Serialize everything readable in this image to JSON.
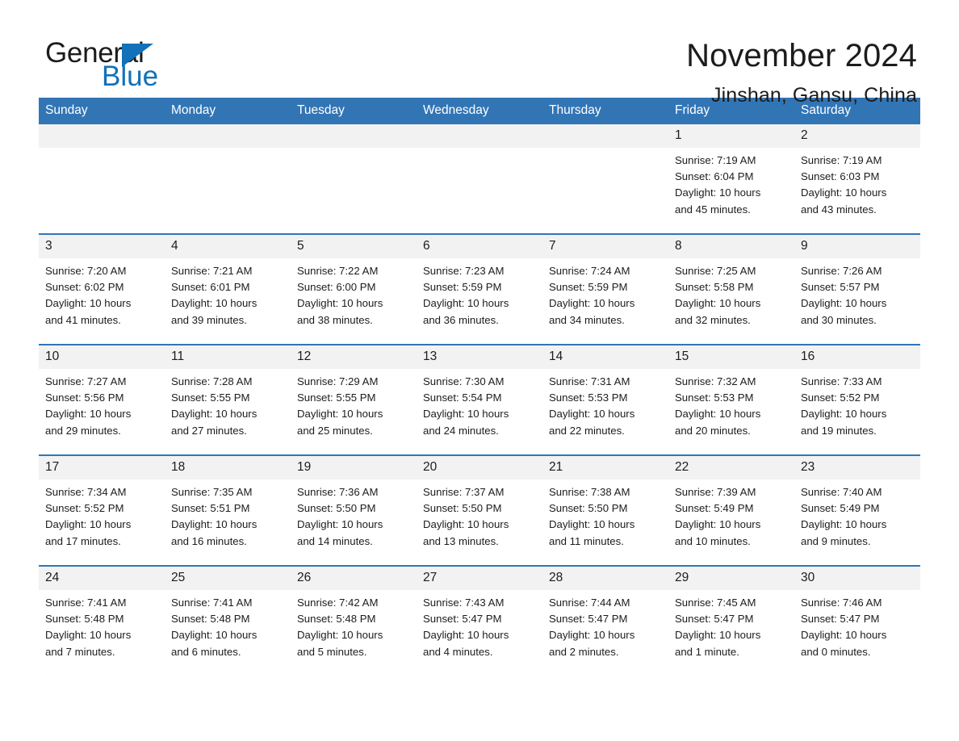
{
  "logo": {
    "word_one": "General",
    "word_two": "Blue",
    "triangle_color": "#1271b8"
  },
  "header": {
    "title": "November 2024",
    "subtitle": "Jinshan, Gansu, China"
  },
  "theme": {
    "header_blue": "#3275b5",
    "daynum_gray": "#f2f2f2",
    "text": "#1c1c1c"
  },
  "calendar": {
    "weekday_headers": [
      "Sunday",
      "Monday",
      "Tuesday",
      "Wednesday",
      "Thursday",
      "Friday",
      "Saturday"
    ],
    "weeks": [
      [
        {
          "day": "",
          "blank": true
        },
        {
          "day": "",
          "blank": true
        },
        {
          "day": "",
          "blank": true
        },
        {
          "day": "",
          "blank": true
        },
        {
          "day": "",
          "blank": true
        },
        {
          "day": "1",
          "sunrise": "Sunrise: 7:19 AM",
          "sunset": "Sunset: 6:04 PM",
          "daylight_1": "Daylight: 10 hours",
          "daylight_2": "and 45 minutes."
        },
        {
          "day": "2",
          "sunrise": "Sunrise: 7:19 AM",
          "sunset": "Sunset: 6:03 PM",
          "daylight_1": "Daylight: 10 hours",
          "daylight_2": "and 43 minutes."
        }
      ],
      [
        {
          "day": "3",
          "sunrise": "Sunrise: 7:20 AM",
          "sunset": "Sunset: 6:02 PM",
          "daylight_1": "Daylight: 10 hours",
          "daylight_2": "and 41 minutes."
        },
        {
          "day": "4",
          "sunrise": "Sunrise: 7:21 AM",
          "sunset": "Sunset: 6:01 PM",
          "daylight_1": "Daylight: 10 hours",
          "daylight_2": "and 39 minutes."
        },
        {
          "day": "5",
          "sunrise": "Sunrise: 7:22 AM",
          "sunset": "Sunset: 6:00 PM",
          "daylight_1": "Daylight: 10 hours",
          "daylight_2": "and 38 minutes."
        },
        {
          "day": "6",
          "sunrise": "Sunrise: 7:23 AM",
          "sunset": "Sunset: 5:59 PM",
          "daylight_1": "Daylight: 10 hours",
          "daylight_2": "and 36 minutes."
        },
        {
          "day": "7",
          "sunrise": "Sunrise: 7:24 AM",
          "sunset": "Sunset: 5:59 PM",
          "daylight_1": "Daylight: 10 hours",
          "daylight_2": "and 34 minutes."
        },
        {
          "day": "8",
          "sunrise": "Sunrise: 7:25 AM",
          "sunset": "Sunset: 5:58 PM",
          "daylight_1": "Daylight: 10 hours",
          "daylight_2": "and 32 minutes."
        },
        {
          "day": "9",
          "sunrise": "Sunrise: 7:26 AM",
          "sunset": "Sunset: 5:57 PM",
          "daylight_1": "Daylight: 10 hours",
          "daylight_2": "and 30 minutes."
        }
      ],
      [
        {
          "day": "10",
          "sunrise": "Sunrise: 7:27 AM",
          "sunset": "Sunset: 5:56 PM",
          "daylight_1": "Daylight: 10 hours",
          "daylight_2": "and 29 minutes."
        },
        {
          "day": "11",
          "sunrise": "Sunrise: 7:28 AM",
          "sunset": "Sunset: 5:55 PM",
          "daylight_1": "Daylight: 10 hours",
          "daylight_2": "and 27 minutes."
        },
        {
          "day": "12",
          "sunrise": "Sunrise: 7:29 AM",
          "sunset": "Sunset: 5:55 PM",
          "daylight_1": "Daylight: 10 hours",
          "daylight_2": "and 25 minutes."
        },
        {
          "day": "13",
          "sunrise": "Sunrise: 7:30 AM",
          "sunset": "Sunset: 5:54 PM",
          "daylight_1": "Daylight: 10 hours",
          "daylight_2": "and 24 minutes."
        },
        {
          "day": "14",
          "sunrise": "Sunrise: 7:31 AM",
          "sunset": "Sunset: 5:53 PM",
          "daylight_1": "Daylight: 10 hours",
          "daylight_2": "and 22 minutes."
        },
        {
          "day": "15",
          "sunrise": "Sunrise: 7:32 AM",
          "sunset": "Sunset: 5:53 PM",
          "daylight_1": "Daylight: 10 hours",
          "daylight_2": "and 20 minutes."
        },
        {
          "day": "16",
          "sunrise": "Sunrise: 7:33 AM",
          "sunset": "Sunset: 5:52 PM",
          "daylight_1": "Daylight: 10 hours",
          "daylight_2": "and 19 minutes."
        }
      ],
      [
        {
          "day": "17",
          "sunrise": "Sunrise: 7:34 AM",
          "sunset": "Sunset: 5:52 PM",
          "daylight_1": "Daylight: 10 hours",
          "daylight_2": "and 17 minutes."
        },
        {
          "day": "18",
          "sunrise": "Sunrise: 7:35 AM",
          "sunset": "Sunset: 5:51 PM",
          "daylight_1": "Daylight: 10 hours",
          "daylight_2": "and 16 minutes."
        },
        {
          "day": "19",
          "sunrise": "Sunrise: 7:36 AM",
          "sunset": "Sunset: 5:50 PM",
          "daylight_1": "Daylight: 10 hours",
          "daylight_2": "and 14 minutes."
        },
        {
          "day": "20",
          "sunrise": "Sunrise: 7:37 AM",
          "sunset": "Sunset: 5:50 PM",
          "daylight_1": "Daylight: 10 hours",
          "daylight_2": "and 13 minutes."
        },
        {
          "day": "21",
          "sunrise": "Sunrise: 7:38 AM",
          "sunset": "Sunset: 5:50 PM",
          "daylight_1": "Daylight: 10 hours",
          "daylight_2": "and 11 minutes."
        },
        {
          "day": "22",
          "sunrise": "Sunrise: 7:39 AM",
          "sunset": "Sunset: 5:49 PM",
          "daylight_1": "Daylight: 10 hours",
          "daylight_2": "and 10 minutes."
        },
        {
          "day": "23",
          "sunrise": "Sunrise: 7:40 AM",
          "sunset": "Sunset: 5:49 PM",
          "daylight_1": "Daylight: 10 hours",
          "daylight_2": "and 9 minutes."
        }
      ],
      [
        {
          "day": "24",
          "sunrise": "Sunrise: 7:41 AM",
          "sunset": "Sunset: 5:48 PM",
          "daylight_1": "Daylight: 10 hours",
          "daylight_2": "and 7 minutes."
        },
        {
          "day": "25",
          "sunrise": "Sunrise: 7:41 AM",
          "sunset": "Sunset: 5:48 PM",
          "daylight_1": "Daylight: 10 hours",
          "daylight_2": "and 6 minutes."
        },
        {
          "day": "26",
          "sunrise": "Sunrise: 7:42 AM",
          "sunset": "Sunset: 5:48 PM",
          "daylight_1": "Daylight: 10 hours",
          "daylight_2": "and 5 minutes."
        },
        {
          "day": "27",
          "sunrise": "Sunrise: 7:43 AM",
          "sunset": "Sunset: 5:47 PM",
          "daylight_1": "Daylight: 10 hours",
          "daylight_2": "and 4 minutes."
        },
        {
          "day": "28",
          "sunrise": "Sunrise: 7:44 AM",
          "sunset": "Sunset: 5:47 PM",
          "daylight_1": "Daylight: 10 hours",
          "daylight_2": "and 2 minutes."
        },
        {
          "day": "29",
          "sunrise": "Sunrise: 7:45 AM",
          "sunset": "Sunset: 5:47 PM",
          "daylight_1": "Daylight: 10 hours",
          "daylight_2": "and 1 minute."
        },
        {
          "day": "30",
          "sunrise": "Sunrise: 7:46 AM",
          "sunset": "Sunset: 5:47 PM",
          "daylight_1": "Daylight: 10 hours",
          "daylight_2": "and 0 minutes."
        }
      ]
    ]
  }
}
